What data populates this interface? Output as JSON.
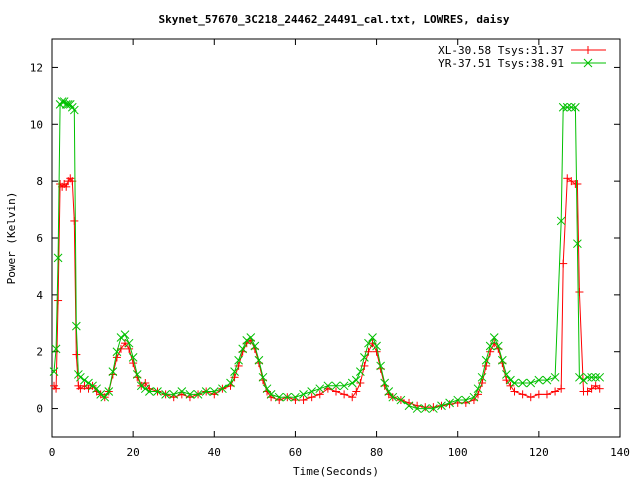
{
  "chart_data": {
    "type": "line",
    "title": "Skynet_57670_3C218_24462_24491_cal.txt, LOWRES, daisy",
    "xlabel": "Time(Seconds)",
    "ylabel": "Power (Kelvin)",
    "xlim": [
      0,
      140
    ],
    "ylim": [
      -1,
      13
    ],
    "xticks": [
      0,
      20,
      40,
      60,
      80,
      100,
      120,
      140
    ],
    "yticks": [
      0,
      2,
      4,
      6,
      8,
      10,
      12
    ],
    "grid": false,
    "legend_position": "top-right",
    "series": [
      {
        "name": "XL-30.58 Tsys:31.37",
        "color": "#ff0000",
        "marker": "plus",
        "x": [
          0.5,
          1.0,
          1.5,
          2.0,
          2.5,
          3.0,
          3.5,
          4.0,
          4.5,
          5.0,
          5.5,
          6.0,
          6.5,
          7.0,
          8.0,
          9.0,
          10.0,
          11.0,
          12.0,
          13.0,
          14.0,
          15.0,
          16.0,
          17.0,
          18.0,
          19.0,
          20.0,
          21.0,
          22.0,
          23.0,
          24.0,
          26.0,
          28.0,
          30.0,
          32.0,
          34.0,
          36.0,
          38.0,
          40.0,
          42.0,
          44.0,
          45.0,
          46.0,
          47.0,
          48.0,
          49.0,
          50.0,
          51.0,
          52.0,
          53.0,
          54.0,
          56.0,
          58.0,
          60.0,
          62.0,
          64.0,
          66.0,
          68.0,
          70.0,
          72.0,
          74.0,
          75.0,
          76.0,
          77.0,
          78.0,
          79.0,
          80.0,
          81.0,
          82.0,
          83.0,
          84.0,
          86.0,
          88.0,
          90.0,
          92.0,
          94.0,
          96.0,
          98.0,
          100.0,
          102.0,
          104.0,
          105.0,
          106.0,
          107.0,
          108.0,
          109.0,
          110.0,
          111.0,
          112.0,
          113.0,
          114.0,
          116.0,
          118.0,
          120.0,
          122.0,
          124.0,
          125.5,
          126.0,
          127.0,
          128.0,
          129.0,
          129.5,
          130.0,
          131.0,
          132.0,
          133.0,
          134.0,
          135.0
        ],
        "y": [
          0.8,
          0.7,
          3.8,
          7.9,
          7.8,
          7.9,
          7.8,
          8.0,
          8.1,
          8.0,
          6.6,
          1.9,
          0.8,
          0.7,
          0.8,
          0.7,
          0.8,
          0.6,
          0.5,
          0.4,
          0.6,
          1.2,
          1.8,
          2.1,
          2.3,
          2.1,
          1.6,
          1.1,
          0.8,
          0.9,
          0.7,
          0.6,
          0.5,
          0.4,
          0.5,
          0.4,
          0.5,
          0.6,
          0.5,
          0.7,
          0.8,
          1.1,
          1.5,
          2.0,
          2.3,
          2.4,
          2.1,
          1.6,
          1.0,
          0.6,
          0.4,
          0.3,
          0.4,
          0.3,
          0.3,
          0.4,
          0.5,
          0.7,
          0.6,
          0.5,
          0.4,
          0.6,
          0.9,
          1.5,
          2.0,
          2.3,
          2.0,
          1.4,
          0.8,
          0.5,
          0.4,
          0.3,
          0.2,
          0.1,
          0.05,
          0.05,
          0.1,
          0.15,
          0.2,
          0.2,
          0.3,
          0.5,
          0.9,
          1.5,
          2.0,
          2.3,
          2.1,
          1.6,
          1.0,
          0.8,
          0.6,
          0.5,
          0.4,
          0.5,
          0.5,
          0.6,
          0.7,
          5.1,
          8.1,
          8.0,
          7.9,
          7.9,
          4.1,
          0.6,
          0.6,
          0.7,
          0.8,
          0.7
        ]
      },
      {
        "name": "YR-37.51 Tsys:38.91",
        "color": "#00c000",
        "marker": "cross",
        "x": [
          0.5,
          1.0,
          1.5,
          2.0,
          2.5,
          3.0,
          3.5,
          4.0,
          4.5,
          5.0,
          5.5,
          6.0,
          6.5,
          7.0,
          8.0,
          9.0,
          10.0,
          11.0,
          12.0,
          13.0,
          14.0,
          15.0,
          16.0,
          17.0,
          18.0,
          19.0,
          20.0,
          21.0,
          22.0,
          23.0,
          24.0,
          26.0,
          28.0,
          30.0,
          32.0,
          34.0,
          36.0,
          38.0,
          40.0,
          42.0,
          44.0,
          45.0,
          46.0,
          47.0,
          48.0,
          49.0,
          50.0,
          51.0,
          52.0,
          53.0,
          54.0,
          56.0,
          58.0,
          60.0,
          62.0,
          64.0,
          66.0,
          68.0,
          70.0,
          72.0,
          74.0,
          75.0,
          76.0,
          77.0,
          78.0,
          79.0,
          80.0,
          81.0,
          82.0,
          83.0,
          84.0,
          86.0,
          88.0,
          90.0,
          92.0,
          94.0,
          96.0,
          98.0,
          100.0,
          102.0,
          104.0,
          105.0,
          106.0,
          107.0,
          108.0,
          109.0,
          110.0,
          111.0,
          112.0,
          113.0,
          114.0,
          116.0,
          118.0,
          120.0,
          122.0,
          124.0,
          125.5,
          126.0,
          127.0,
          128.0,
          129.0,
          129.5,
          130.0,
          131.0,
          132.0,
          133.0,
          134.0,
          135.0
        ],
        "y": [
          1.3,
          2.1,
          5.3,
          10.7,
          10.8,
          10.8,
          10.7,
          10.7,
          10.7,
          10.6,
          10.5,
          2.9,
          1.2,
          1.1,
          1.0,
          0.9,
          0.8,
          0.7,
          0.5,
          0.4,
          0.6,
          1.3,
          2.0,
          2.5,
          2.6,
          2.3,
          1.8,
          1.2,
          0.8,
          0.7,
          0.6,
          0.6,
          0.5,
          0.5,
          0.6,
          0.5,
          0.5,
          0.6,
          0.6,
          0.7,
          0.9,
          1.3,
          1.7,
          2.1,
          2.4,
          2.5,
          2.2,
          1.7,
          1.1,
          0.7,
          0.5,
          0.4,
          0.4,
          0.4,
          0.5,
          0.6,
          0.7,
          0.8,
          0.8,
          0.8,
          0.9,
          1.0,
          1.3,
          1.8,
          2.3,
          2.5,
          2.2,
          1.5,
          0.9,
          0.6,
          0.4,
          0.3,
          0.1,
          0.0,
          0.0,
          0.0,
          0.1,
          0.2,
          0.3,
          0.3,
          0.4,
          0.7,
          1.1,
          1.7,
          2.2,
          2.5,
          2.2,
          1.7,
          1.2,
          1.0,
          0.9,
          0.9,
          0.9,
          1.0,
          1.0,
          1.1,
          6.6,
          10.6,
          10.6,
          10.6,
          10.6,
          5.8,
          1.1,
          1.0,
          1.1,
          1.1,
          1.1,
          1.1
        ]
      }
    ]
  }
}
